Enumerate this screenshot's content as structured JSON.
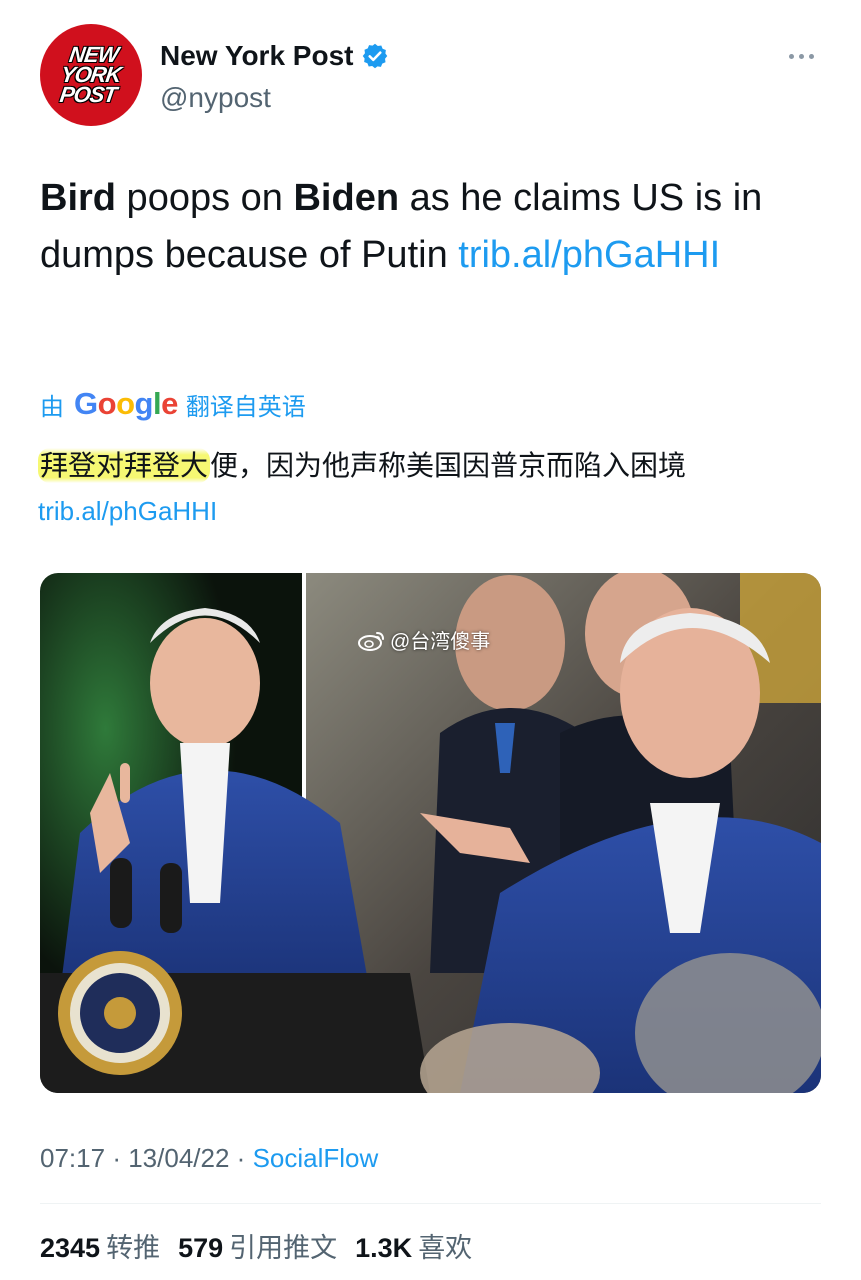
{
  "tweet": {
    "author": {
      "display_name": "New York Post",
      "handle": "@nypost",
      "verified": true,
      "avatar_logo_lines": [
        "NEW",
        "YORK",
        "POST"
      ]
    },
    "text_parts": [
      {
        "text": "Bird",
        "bold": true
      },
      {
        "text": " poops on ",
        "bold": false
      },
      {
        "text": "Biden",
        "bold": true
      },
      {
        "text": " as he claims US is in dumps because of Putin ",
        "bold": false
      }
    ],
    "link": "trib.al/phGaHHI",
    "translation": {
      "prefix": "由",
      "provider": "Google",
      "suffix": "翻译自英语",
      "highlighted_text": "拜登对拜登大",
      "rest_text": "便，因为他声称美国因普京而陷入困境",
      "link": "trib.al/phGaHHI"
    },
    "media": {
      "watermark": "@台湾傻事",
      "seal_text": "SEAL OF THE PRESIDENT OF THE UNITED STATES"
    },
    "meta": {
      "time": "07:17",
      "date": "13/04/22",
      "separator": "·",
      "source": "SocialFlow"
    },
    "stats": [
      {
        "num": "2345",
        "label": "转推"
      },
      {
        "num": "579",
        "label": "引用推文"
      },
      {
        "num": "1.3K",
        "label": "喜欢"
      }
    ]
  },
  "colors": {
    "accent": "#1d9bf0",
    "brand_red": "#d0101d",
    "highlight": "#f5f764",
    "secondary_text": "#536471"
  },
  "icons": [
    "verified-badge-icon",
    "more-options-icon",
    "weibo-icon"
  ]
}
